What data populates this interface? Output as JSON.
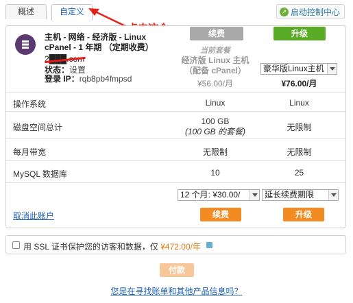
{
  "tabs": {
    "overview": "概述",
    "custom": "自定义"
  },
  "control_panel_link": "启动控制中心",
  "annotation": "点击这个",
  "product": {
    "title": "主机 - 网络 - 经济版 - Linux cPanel - 1 年期 （定期收费）",
    "domain": "2███.com",
    "status_label": "状态：",
    "status_value": "设置",
    "login_label": "登录 IP：",
    "login_value": "rqb8pb4fmpsd"
  },
  "buttons": {
    "renew_top": "续费",
    "upgrade_top": "升级",
    "renew_bottom": "续费",
    "upgrade_bottom": "升级",
    "pay": "付款"
  },
  "current_plan": {
    "label": "当前套餐",
    "name": "经济版 Linux 主机（配备 cPanel）",
    "price": "¥56.00/月"
  },
  "new_plan": {
    "selected": "豪华版Linux主机",
    "price": "¥76.00/月"
  },
  "rows": [
    {
      "label": "操作系统",
      "current": "Linux",
      "new": "Linux"
    },
    {
      "label": "磁盘空间总计",
      "current": "100 GB",
      "current_sub": "(100 GB 的套餐)",
      "new": "无限制"
    },
    {
      "label": "每月带宽",
      "current": "无限制",
      "new": "无限制"
    },
    {
      "label": "MySQL 数据库",
      "current": "10",
      "new": "25"
    }
  ],
  "period_select": "12 个月: ¥30.00/",
  "extend_select": "延长续费期限",
  "cancel_link": "取消此账户",
  "ssl": {
    "text": "用 SSL 证书保护您的访客和数据，仅 ",
    "price": "¥472.00/年"
  },
  "help_link": "您是在寻找账单和其他产品信息吗？",
  "colors": {
    "green": "#5aac27",
    "orange": "#f28c22",
    "link": "#1a5fb4",
    "annotation": "#e2231a"
  }
}
